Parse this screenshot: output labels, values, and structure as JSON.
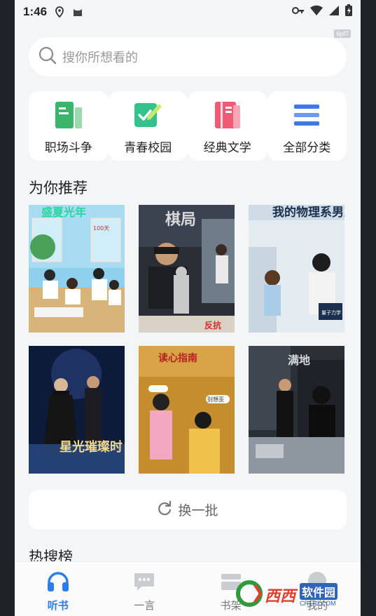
{
  "status_bar": {
    "time": "1:46"
  },
  "tag": "6pf7",
  "search": {
    "placeholder": "搜你所想看的"
  },
  "categories": [
    {
      "label": "职场斗争",
      "icon": "book-green-icon",
      "color": "#3bb56b"
    },
    {
      "label": "青春校园",
      "icon": "notebook-pen-icon",
      "color": "#35c18c"
    },
    {
      "label": "经典文学",
      "icon": "book-pink-icon",
      "color": "#f05a74"
    },
    {
      "label": "全部分类",
      "icon": "list-icon",
      "color": "#3f78e8"
    }
  ],
  "recommend": {
    "title": "为你推荐",
    "books": [
      {
        "cover_title": "盛夏光年",
        "cover_text": [
          "100天"
        ],
        "palette": [
          "#7fc7e8",
          "#3f8a4a",
          "#e9c98a"
        ]
      },
      {
        "cover_title": "棋局",
        "cover_text": [
          "反抗"
        ],
        "palette": [
          "#2a2e35",
          "#6a4a2a",
          "#c9c9c9"
        ]
      },
      {
        "cover_title": "我的物理系男友",
        "cover_text": [
          "量子力学"
        ],
        "palette": [
          "#dfe7ee",
          "#6fa7d3",
          "#1b2f4f"
        ]
      },
      {
        "cover_title": "星光璀璨时",
        "cover_text": [],
        "palette": [
          "#0d1b3a",
          "#3a5fa0",
          "#e9c98a"
        ]
      },
      {
        "cover_title": "读心指南",
        "cover_text": [
          "别想歪"
        ],
        "palette": [
          "#b9832a",
          "#f1c45a",
          "#e98aa6"
        ]
      },
      {
        "cover_title": "满地",
        "cover_text": [],
        "palette": [
          "#2b2f36",
          "#5c6470",
          "#c8cdd4"
        ]
      }
    ],
    "refresh_label": "换一批"
  },
  "hot": {
    "title": "热搜榜"
  },
  "tabbar": {
    "items": [
      {
        "label": "听书",
        "icon": "headphones-icon",
        "active": true
      },
      {
        "label": "一言",
        "icon": "chat-bubble-icon",
        "active": false
      },
      {
        "label": "书架",
        "icon": "bookshelf-icon",
        "active": false
      },
      {
        "label": "我的",
        "icon": "profile-icon",
        "active": false
      }
    ]
  },
  "watermark": {
    "brand": "西西",
    "cn": "软件园",
    "url": "CR173.COM"
  }
}
